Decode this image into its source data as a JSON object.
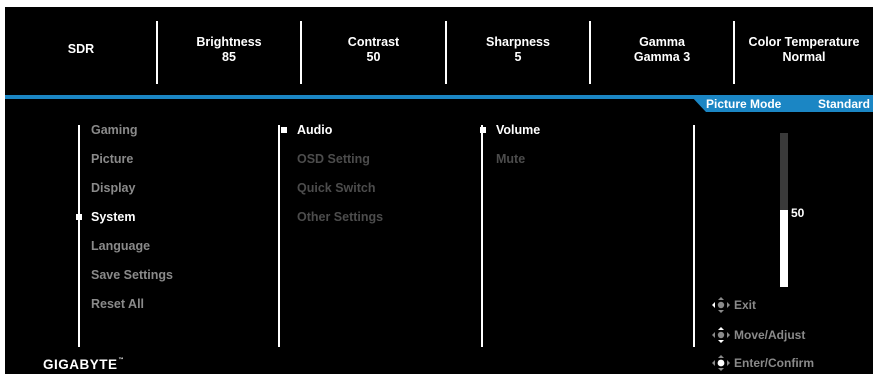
{
  "top_bar": {
    "items": [
      {
        "title": "SDR",
        "value": ""
      },
      {
        "title": "Brightness",
        "value": "85"
      },
      {
        "title": "Contrast",
        "value": "50"
      },
      {
        "title": "Sharpness",
        "value": "5"
      },
      {
        "title": "Gamma",
        "value": "Gamma 3"
      },
      {
        "title": "Color Temperature",
        "value": "Normal"
      }
    ]
  },
  "picture_mode": {
    "label": "Picture Mode",
    "value": "Standard"
  },
  "main_menu": {
    "items": [
      "Gaming",
      "Picture",
      "Display",
      "System",
      "Language",
      "Save Settings",
      "Reset All"
    ],
    "selected": "System"
  },
  "system_menu": {
    "items": [
      "Audio",
      "OSD Setting",
      "Quick Switch",
      "Other Settings"
    ],
    "selected": "Audio"
  },
  "audio_menu": {
    "items": [
      "Volume",
      "Mute"
    ],
    "selected": "Volume"
  },
  "volume_slider": {
    "value": "50",
    "level_fraction": 0.5
  },
  "hints": {
    "exit": "Exit",
    "move": "Move/Adjust",
    "enter": "Enter/Confirm"
  },
  "brand": {
    "logo_text": "GIGABYTE"
  },
  "colors": {
    "accent": "#1b86c4",
    "background": "#000000",
    "text_active": "#ffffff",
    "text_inactive": "#8a8a8a",
    "text_disabled": "#4c4c4c"
  }
}
